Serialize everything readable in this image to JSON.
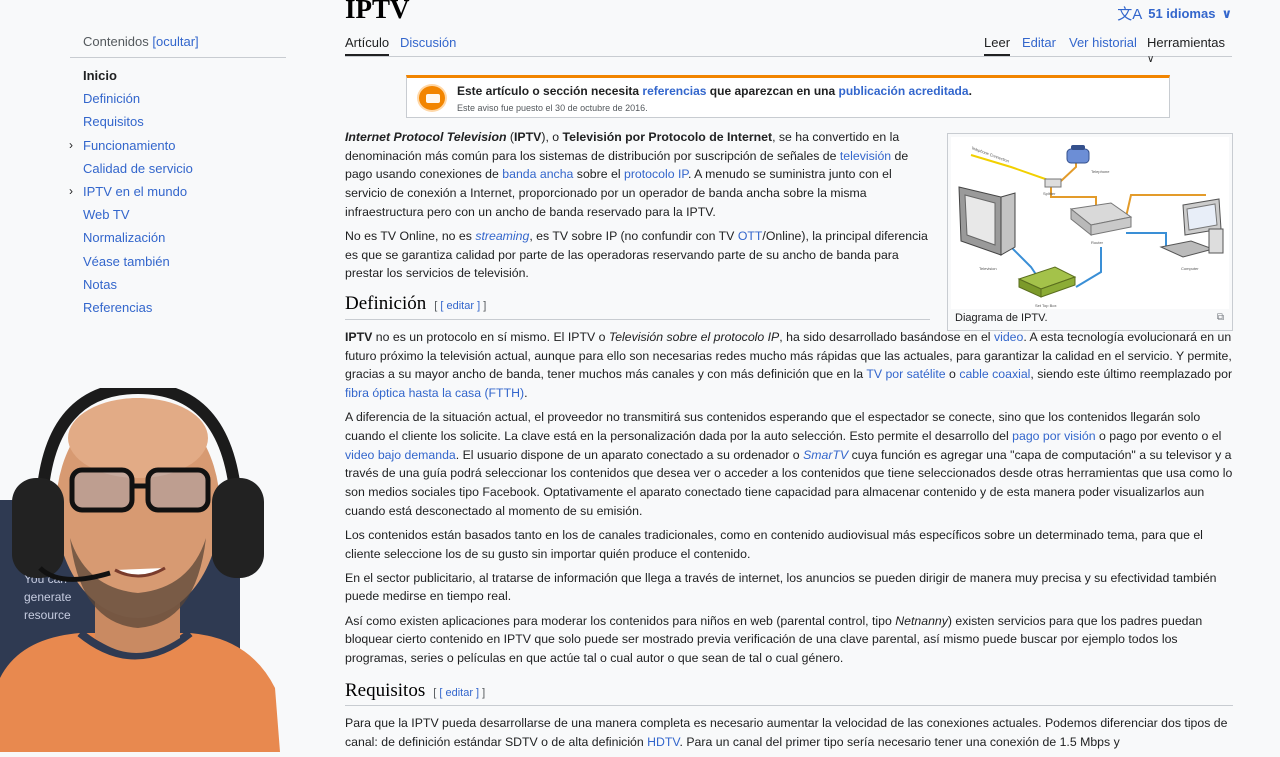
{
  "toc": {
    "heading": "Contenidos",
    "toggle": "[ocultar]",
    "items": [
      {
        "label": "Inicio",
        "active": true,
        "expandable": false
      },
      {
        "label": "Definición",
        "active": false,
        "expandable": false
      },
      {
        "label": "Requisitos",
        "active": false,
        "expandable": false
      },
      {
        "label": "Funcionamiento",
        "active": false,
        "expandable": true
      },
      {
        "label": "Calidad de servicio",
        "active": false,
        "expandable": false
      },
      {
        "label": "IPTV en el mundo",
        "active": false,
        "expandable": true
      },
      {
        "label": "Web TV",
        "active": false,
        "expandable": false
      },
      {
        "label": "Normalización",
        "active": false,
        "expandable": false
      },
      {
        "label": "Véase también",
        "active": false,
        "expandable": false
      },
      {
        "label": "Notas",
        "active": false,
        "expandable": false
      },
      {
        "label": "Referencias",
        "active": false,
        "expandable": false
      }
    ]
  },
  "header": {
    "title": "IPTV",
    "languages": "51 idiomas",
    "tabs_left": [
      "Artículo",
      "Discusión"
    ],
    "tabs_right": [
      "Leer",
      "Editar",
      "Ver historial",
      "Herramientas"
    ]
  },
  "notice": {
    "text_a": "Este artículo o sección necesita ",
    "link_a": "referencias",
    "text_b": " que aparezcan en una ",
    "link_b": "publicación acreditada",
    "text_c": ".",
    "date_line": "Este aviso fue puesto el 30 de octubre de 2016."
  },
  "thumb": {
    "caption": "Diagrama de IPTV.",
    "labels": {
      "tc": "Telephone Connection",
      "tel": "Telephone",
      "spl": "Splitter",
      "rou": "Router",
      "comp": "Computer",
      "tv": "Television",
      "stb": "Set Top Box"
    }
  },
  "intro": {
    "p1": {
      "s1": "Internet Protocol Television",
      "s2": " (",
      "s3": "IPTV",
      "s4": "), o ",
      "s5": "Televisión por Protocolo de Internet",
      "s6": ", se ha convertido en la denominación más común para los sistemas de distribución por suscripción de señales de ",
      "l1": "televisión",
      "s7": " de pago usando conexiones de ",
      "l2": "banda ancha",
      "s8": " sobre el ",
      "l3": "protocolo IP",
      "s9": ". A menudo se suministra junto con el servicio de conexión a Internet, proporcionado por un operador de banda ancha sobre la misma infraestructura pero con un ancho de banda reservado para la IPTV."
    },
    "p2": {
      "s1": "No es TV Online, no es ",
      "l1": "streaming",
      "s2": ", es TV sobre IP (no confundir con TV ",
      "l2": "OTT",
      "s3": "/Online), la principal diferencia es que se garantiza calidad por parte de las operadoras reservando parte de su ancho de banda para prestar los servicios de televisión."
    }
  },
  "definicion": {
    "heading": "Definición",
    "edit": "[ editar ]",
    "p1": {
      "s1": "IPTV",
      "s2": " no es un protocolo en sí mismo. El IPTV o ",
      "s3": "Televisión sobre el protocolo IP",
      "s4": ", ha sido desarrollado basándose en el ",
      "l1": "video",
      "s5": ". A esta tecnología evolucionará en un futuro próximo la televisión actual, aunque para ello son necesarias redes mucho más rápidas que las actuales, para garantizar la calidad en el servicio. Y permite, gracias a su mayor ancho de banda, tener muchos más canales y con más definición que en la ",
      "l2": "TV por satélite",
      "s6": " o ",
      "l3": "cable coaxial",
      "s7": ", siendo este último reemplazado por ",
      "l4": "fibra óptica hasta la casa (FTTH)",
      "s8": "."
    },
    "p2": {
      "s1": "A diferencia de la situación actual, el proveedor no transmitirá sus contenidos esperando que el espectador se conecte, sino que los contenidos llegarán solo cuando el cliente los solicite. La clave está en la personalización dada por la auto selección. Esto permite el desarrollo del ",
      "l1": "pago por visión",
      "s2": " o pago por evento o el ",
      "l2": "video bajo demanda",
      "s3": ". El usuario dispone de un aparato conectado a su ordenador o ",
      "l3": "SmarTV",
      "s4": " cuya función es agregar una \"capa de computación\" a su televisor y a través de una guía podrá seleccionar los contenidos que desea ver o acceder a los contenidos que tiene seleccionados desde otras herramientas que usa como lo son medios sociales tipo Facebook. Optativamente el aparato conectado tiene capacidad para almacenar contenido y de esta manera poder visualizarlos aun cuando está desconectado al momento de su emisión."
    },
    "p3": "Los contenidos están basados tanto en los de canales tradicionales, como en contenido audiovisual más específicos sobre un determinado tema, para que el cliente seleccione los de su gusto sin importar quién produce el contenido.",
    "p4": "En el sector publicitario, al tratarse de información que llega a través de internet, los anuncios se pueden dirigir de manera muy precisa y su efectividad también puede medirse en tiempo real.",
    "p5": {
      "s1": "Así como existen aplicaciones para moderar los contenidos para niños en web (parental control, tipo ",
      "s2": "Netnanny",
      "s3": ") existen servicios para que los padres puedan bloquear cierto contenido en IPTV que solo puede ser mostrado previa verificación de una clave parental, así mismo puede buscar por ejemplo todos los programas, series o películas en que actúe tal o cual autor o que sean de tal o cual género."
    }
  },
  "requisitos": {
    "heading": "Requisitos",
    "edit": "[ editar ]",
    "p1": {
      "s1": "Para que la IPTV pueda desarrollarse de una manera completa es necesario aumentar la velocidad de las conexiones actuales. Podemos diferenciar dos tipos de canal: de definición estándar SDTV o de alta definición ",
      "l1": "HDTV",
      "s2": ". Para un canal del primer tipo sería necesario tener una conexión de 1.5 Mbps y"
    }
  },
  "webcam": {
    "bg_line1": "You can",
    "bg_line2": "generate",
    "bg_line3": "resource"
  },
  "colors": {
    "link": "#3366cc",
    "notice_accent": "#f28500",
    "text": "#202122",
    "background": "#f8f9fa"
  }
}
